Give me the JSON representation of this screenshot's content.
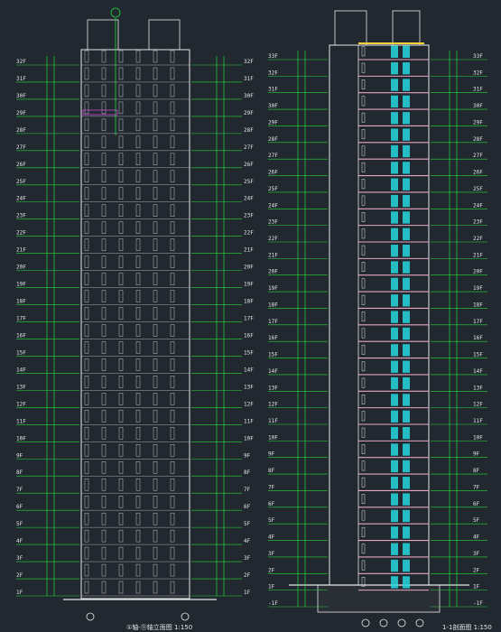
{
  "drawing": {
    "left_elevation": {
      "title": "①轴-⑪轴立面图 1:150",
      "floors_bottom_to_top": [
        "1F",
        "2F",
        "3F",
        "4F",
        "5F",
        "6F",
        "7F",
        "8F",
        "9F",
        "10F",
        "11F",
        "12F",
        "13F",
        "14F",
        "15F",
        "16F",
        "17F",
        "18F",
        "19F",
        "20F",
        "21F",
        "22F",
        "23F",
        "24F",
        "25F",
        "26F",
        "27F",
        "28F",
        "29F",
        "30F",
        "31F",
        "32F"
      ]
    },
    "right_section": {
      "title": "1-1剖面图 1:150",
      "floors_bottom_to_top": [
        "-1F",
        "1F",
        "2F",
        "3F",
        "4F",
        "5F",
        "6F",
        "7F",
        "8F",
        "9F",
        "10F",
        "11F",
        "12F",
        "13F",
        "14F",
        "15F",
        "16F",
        "17F",
        "18F",
        "19F",
        "20F",
        "21F",
        "22F",
        "23F",
        "24F",
        "25F",
        "26F",
        "27F",
        "28F",
        "29F",
        "30F",
        "31F",
        "32F",
        "33F"
      ]
    },
    "colors": {
      "background": "#212830",
      "dimension_green": "#27d83a",
      "outline_white": "#e8e8e8",
      "section_pink": "#e7a6c1",
      "door_cyan": "#27d6de",
      "accent_yellow": "#f0d23a",
      "accent_magenta": "#d04ad8"
    }
  }
}
